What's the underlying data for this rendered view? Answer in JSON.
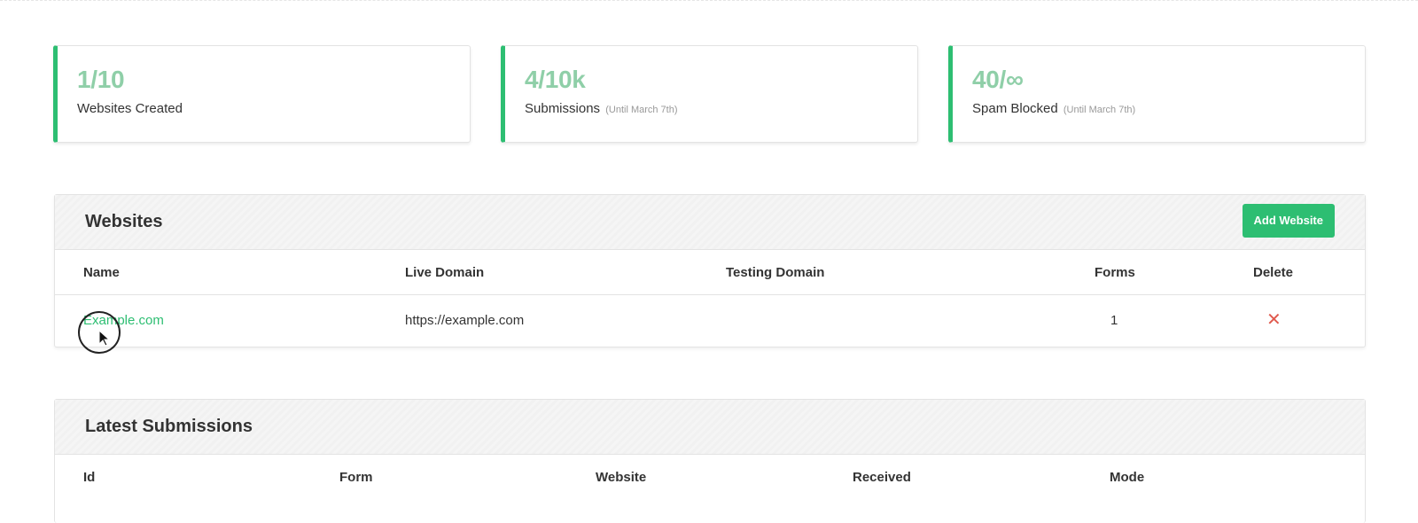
{
  "stats": [
    {
      "value": "1/10",
      "label": "Websites Created",
      "note": ""
    },
    {
      "value": "4/10k",
      "label": "Submissions",
      "note": "(Until March 7th)"
    },
    {
      "value": "40/∞",
      "label": "Spam Blocked",
      "note": "(Until March 7th)"
    }
  ],
  "websites": {
    "title": "Websites",
    "add_label": "Add Website",
    "columns": {
      "name": "Name",
      "live": "Live Domain",
      "testing": "Testing Domain",
      "forms": "Forms",
      "delete": "Delete"
    },
    "rows": [
      {
        "name": "Example.com",
        "live": "https://example.com",
        "testing": "",
        "forms": "1",
        "delete": "✕"
      }
    ]
  },
  "submissions": {
    "title": "Latest Submissions",
    "columns": {
      "id": "Id",
      "form": "Form",
      "website": "Website",
      "received": "Received",
      "mode": "Mode"
    }
  },
  "colors": {
    "accent": "#2dbe72",
    "stat_value": "#8fcfa8",
    "danger": "#e05a4e"
  }
}
